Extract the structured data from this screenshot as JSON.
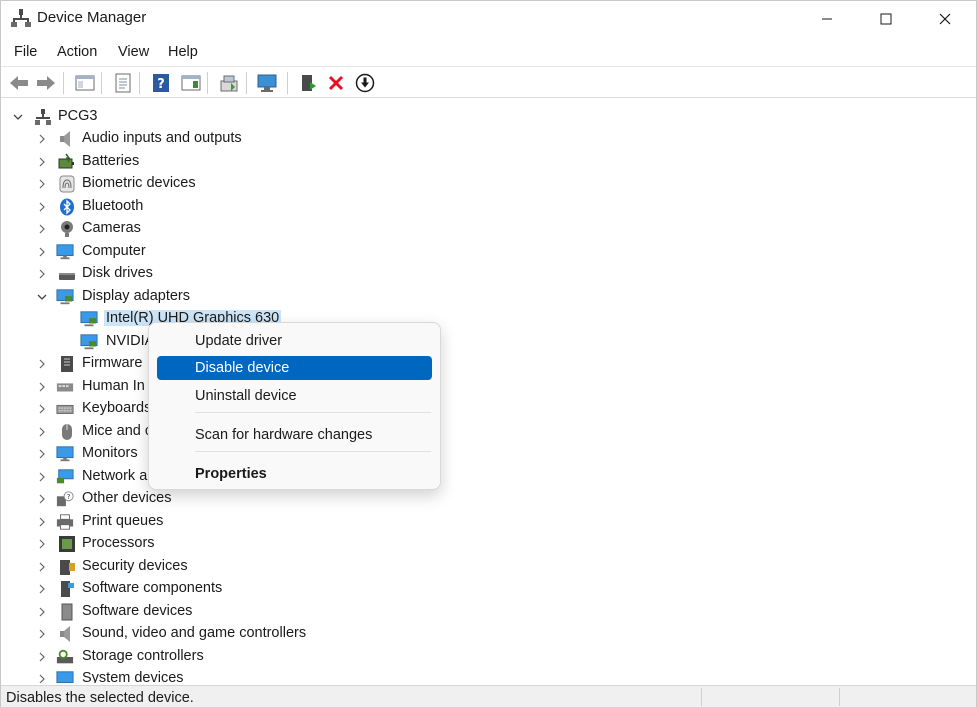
{
  "window": {
    "title": "Device Manager",
    "controls": {
      "minimize": "minimize",
      "maximize": "maximize",
      "close": "close"
    }
  },
  "menu": {
    "file": "File",
    "action": "Action",
    "view": "View",
    "help": "Help"
  },
  "toolbar": {
    "icons": [
      "back-icon",
      "forward-icon",
      "show-hide-console-tree-icon",
      "properties-icon",
      "help-icon",
      "action-pane-icon",
      "update-driver-icon",
      "scan-hardware-icon",
      "enable-device-icon",
      "uninstall-icon",
      "disable-device-icon"
    ]
  },
  "tree": {
    "root": "PCG3",
    "categories": [
      {
        "label": "Audio inputs and outputs",
        "icon": "speaker-icon",
        "expanded": false
      },
      {
        "label": "Batteries",
        "icon": "battery-icon",
        "expanded": false
      },
      {
        "label": "Biometric devices",
        "icon": "fingerprint-icon",
        "expanded": false
      },
      {
        "label": "Bluetooth",
        "icon": "bluetooth-icon",
        "expanded": false
      },
      {
        "label": "Cameras",
        "icon": "camera-icon",
        "expanded": false
      },
      {
        "label": "Computer",
        "icon": "computer-icon",
        "expanded": false
      },
      {
        "label": "Disk drives",
        "icon": "disk-icon",
        "expanded": false
      },
      {
        "label": "Display adapters",
        "icon": "display-adapter-icon",
        "expanded": true
      },
      {
        "label": "Firmware",
        "icon": "firmware-icon",
        "expanded": false
      },
      {
        "label": "Human In",
        "icon": "hid-icon",
        "expanded": false
      },
      {
        "label": "Keyboards",
        "icon": "keyboard-icon",
        "expanded": false
      },
      {
        "label": "Mice and c",
        "icon": "mouse-icon",
        "expanded": false
      },
      {
        "label": "Monitors",
        "icon": "monitor-icon",
        "expanded": false
      },
      {
        "label": "Network a",
        "icon": "network-icon",
        "expanded": false
      },
      {
        "label": "Other devices",
        "icon": "unknown-device-icon",
        "expanded": false
      },
      {
        "label": "Print queues",
        "icon": "printer-icon",
        "expanded": false
      },
      {
        "label": "Processors",
        "icon": "processor-icon",
        "expanded": false
      },
      {
        "label": "Security devices",
        "icon": "security-icon",
        "expanded": false
      },
      {
        "label": "Software components",
        "icon": "software-component-icon",
        "expanded": false
      },
      {
        "label": "Software devices",
        "icon": "software-device-icon",
        "expanded": false
      },
      {
        "label": "Sound, video and game controllers",
        "icon": "sound-icon",
        "expanded": false
      },
      {
        "label": "Storage controllers",
        "icon": "storage-icon",
        "expanded": false
      },
      {
        "label": "System devices",
        "icon": "system-icon",
        "expanded": false
      }
    ],
    "display_children": [
      {
        "label": "Intel(R) UHD Graphics 630",
        "selected": true
      },
      {
        "label": "NVIDIA",
        "selected": false
      }
    ]
  },
  "context_menu": {
    "items": [
      {
        "label": "Update driver"
      },
      {
        "label": "Disable device",
        "highlighted": true
      },
      {
        "label": "Uninstall device"
      },
      {
        "label": "Scan for hardware changes"
      },
      {
        "label": "Properties",
        "bold": true
      }
    ]
  },
  "status": {
    "text": "Disables the selected device."
  },
  "colors": {
    "accent": "#0067c0",
    "selection": "#cce4f7",
    "disable_red": "#e81123"
  }
}
